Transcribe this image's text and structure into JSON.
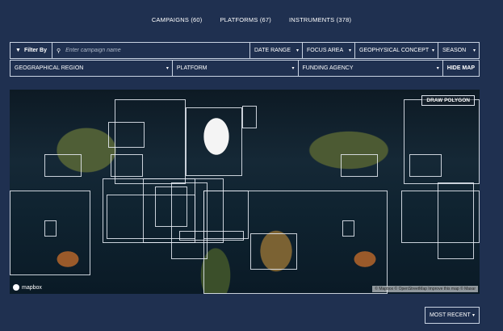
{
  "nav": {
    "campaigns": "CAMPAIGNS (60)",
    "platforms": "PLATFORMS (67)",
    "instruments": "INSTRUMENTS (378)"
  },
  "filter": {
    "filter_by": "Filter By",
    "search_placeholder": "Enter campaign name",
    "date_range": "DATE RANGE",
    "focus_area": "FOCUS AREA",
    "geophysical_concept": "GEOPHYSICAL CONCEPT",
    "season": "SEASON",
    "geographical_region": "GEOGRAPHICAL REGION",
    "platform": "PLATFORM",
    "funding_agency": "FUNDING AGENCY",
    "hide_map": "HIDE MAP"
  },
  "map": {
    "draw_polygon": "DRAW POLYGON",
    "logo_text": "mapbox",
    "attribution": "© Mapbox © OpenStreetMap  Improve this map  © Maxar"
  },
  "sort": {
    "label": "MOST RECENT"
  }
}
